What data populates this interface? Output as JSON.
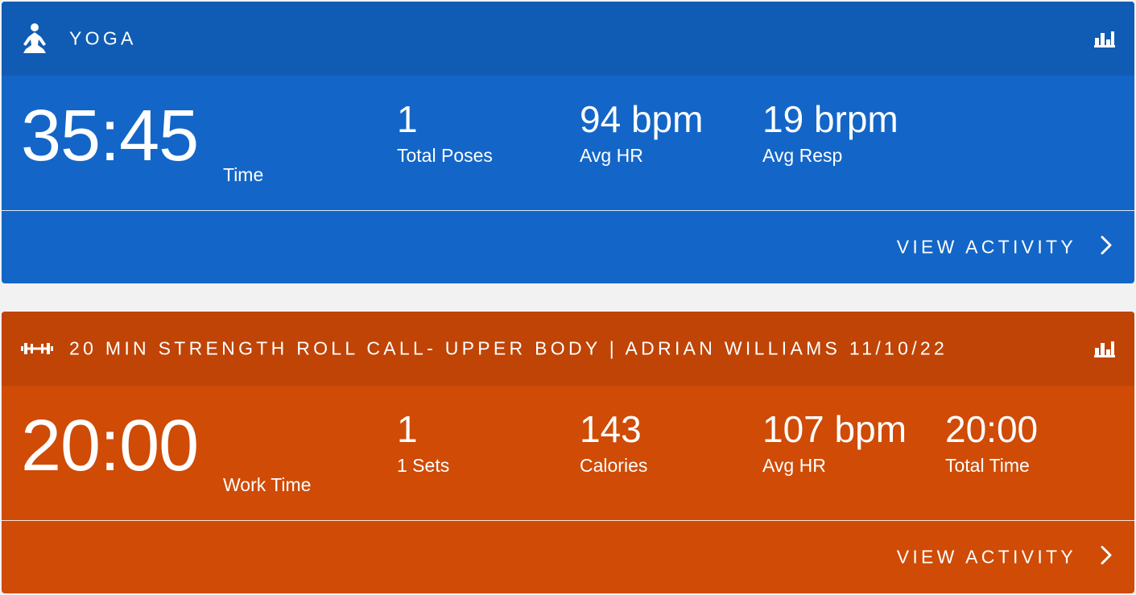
{
  "cards": [
    {
      "type_icon": "yoga-pose-icon",
      "title": "YOGA",
      "stats_icon": "bar-chart-icon",
      "main": {
        "value": "35:45",
        "label": "Time"
      },
      "stats": [
        {
          "value": "1",
          "label": "Total Poses"
        },
        {
          "value": "94 bpm",
          "label": "Avg HR"
        },
        {
          "value": "19 brpm",
          "label": "Avg Resp"
        }
      ],
      "footer": {
        "label": "VIEW ACTIVITY",
        "icon": "chevron-right-icon"
      },
      "color": "#1366c7"
    },
    {
      "type_icon": "dumbbell-icon",
      "title": "20 MIN STRENGTH ROLL CALL- UPPER BODY | ADRIAN WILLIAMS 11/10/22",
      "stats_icon": "bar-chart-icon",
      "main": {
        "value": "20:00",
        "label": "Work Time"
      },
      "stats": [
        {
          "value": "1",
          "label": "1 Sets"
        },
        {
          "value": "143",
          "label": "Calories"
        },
        {
          "value": "107 bpm",
          "label": "Avg HR"
        },
        {
          "value": "20:00",
          "label": "Total Time"
        }
      ],
      "footer": {
        "label": "VIEW ACTIVITY",
        "icon": "chevron-right-icon"
      },
      "color": "#cf4b06"
    }
  ]
}
